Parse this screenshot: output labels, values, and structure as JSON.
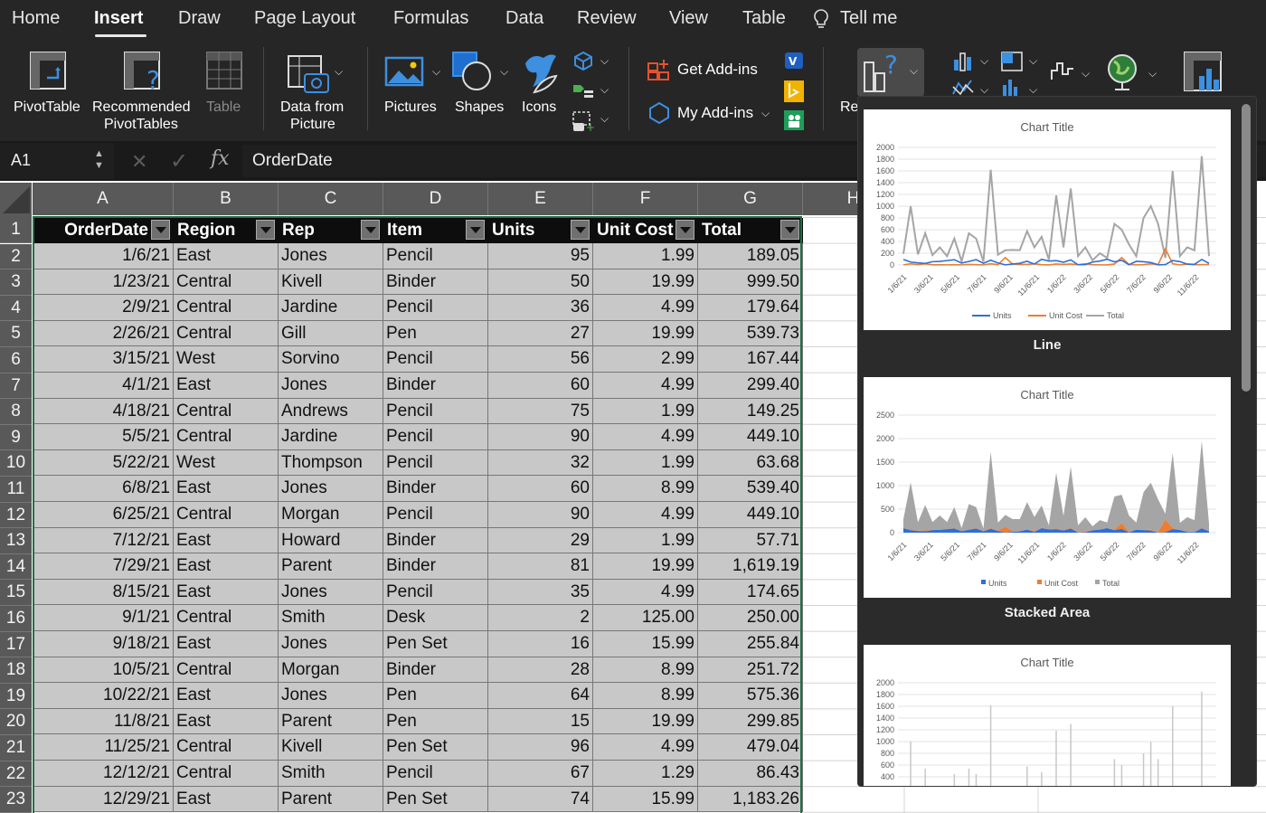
{
  "tabs": [
    "Home",
    "Insert",
    "Draw",
    "Page Layout",
    "Formulas",
    "Data",
    "Review",
    "View",
    "Table",
    "Tell me"
  ],
  "active_tab": "Insert",
  "ribbon": {
    "pivottable": "PivotTable",
    "recommended_pivottables_1": "Recommended",
    "recommended_pivottables_2": "PivotTables",
    "table": "Table",
    "data_from_picture_1": "Data from",
    "data_from_picture_2": "Picture",
    "pictures": "Pictures",
    "shapes": "Shapes",
    "icons": "Icons",
    "get_addins": "Get Add-ins",
    "my_addins": "My Add-ins",
    "recommended_charts_partial": "Re"
  },
  "formula_bar": {
    "name_box": "A1",
    "fx": "fx",
    "content": "OrderDate"
  },
  "columns": [
    "A",
    "B",
    "C",
    "D",
    "E",
    "F",
    "G",
    "H"
  ],
  "headers": [
    "OrderDate",
    "Region",
    "Rep",
    "Item",
    "Units",
    "Unit Cost",
    "Total"
  ],
  "rows": [
    [
      "1/6/21",
      "East",
      "Jones",
      "Pencil",
      "95",
      "1.99",
      "189.05"
    ],
    [
      "1/23/21",
      "Central",
      "Kivell",
      "Binder",
      "50",
      "19.99",
      "999.50"
    ],
    [
      "2/9/21",
      "Central",
      "Jardine",
      "Pencil",
      "36",
      "4.99",
      "179.64"
    ],
    [
      "2/26/21",
      "Central",
      "Gill",
      "Pen",
      "27",
      "19.99",
      "539.73"
    ],
    [
      "3/15/21",
      "West",
      "Sorvino",
      "Pencil",
      "56",
      "2.99",
      "167.44"
    ],
    [
      "4/1/21",
      "East",
      "Jones",
      "Binder",
      "60",
      "4.99",
      "299.40"
    ],
    [
      "4/18/21",
      "Central",
      "Andrews",
      "Pencil",
      "75",
      "1.99",
      "149.25"
    ],
    [
      "5/5/21",
      "Central",
      "Jardine",
      "Pencil",
      "90",
      "4.99",
      "449.10"
    ],
    [
      "5/22/21",
      "West",
      "Thompson",
      "Pencil",
      "32",
      "1.99",
      "63.68"
    ],
    [
      "6/8/21",
      "East",
      "Jones",
      "Binder",
      "60",
      "8.99",
      "539.40"
    ],
    [
      "6/25/21",
      "Central",
      "Morgan",
      "Pencil",
      "90",
      "4.99",
      "449.10"
    ],
    [
      "7/12/21",
      "East",
      "Howard",
      "Binder",
      "29",
      "1.99",
      "57.71"
    ],
    [
      "7/29/21",
      "East",
      "Parent",
      "Binder",
      "81",
      "19.99",
      "1,619.19"
    ],
    [
      "8/15/21",
      "East",
      "Jones",
      "Pencil",
      "35",
      "4.99",
      "174.65"
    ],
    [
      "9/1/21",
      "Central",
      "Smith",
      "Desk",
      "2",
      "125.00",
      "250.00"
    ],
    [
      "9/18/21",
      "East",
      "Jones",
      "Pen Set",
      "16",
      "15.99",
      "255.84"
    ],
    [
      "10/5/21",
      "Central",
      "Morgan",
      "Binder",
      "28",
      "8.99",
      "251.72"
    ],
    [
      "10/22/21",
      "East",
      "Jones",
      "Pen",
      "64",
      "8.99",
      "575.36"
    ],
    [
      "11/8/21",
      "East",
      "Parent",
      "Pen",
      "15",
      "19.99",
      "299.85"
    ],
    [
      "11/25/21",
      "Central",
      "Kivell",
      "Pen Set",
      "96",
      "4.99",
      "479.04"
    ],
    [
      "12/12/21",
      "Central",
      "Smith",
      "Pencil",
      "67",
      "1.29",
      "86.43"
    ],
    [
      "12/29/21",
      "East",
      "Parent",
      "Pen Set",
      "74",
      "15.99",
      "1,183.26"
    ]
  ],
  "row_numbers": [
    "1",
    "2",
    "3",
    "4",
    "5",
    "6",
    "7",
    "8",
    "9",
    "10",
    "11",
    "12",
    "13",
    "14",
    "15",
    "16",
    "17",
    "18",
    "19",
    "20",
    "21",
    "22",
    "23"
  ],
  "colors": {
    "units": "#2e6fd6",
    "unit_cost": "#ed7d31",
    "total": "#a5a5a5"
  },
  "chart_gallery": {
    "chart_title": "Chart Title",
    "x_labels": [
      "1/6/21",
      "3/6/21",
      "5/6/21",
      "7/6/21",
      "9/6/21",
      "11/6/21",
      "1/6/22",
      "3/6/22",
      "5/6/22",
      "7/6/22",
      "9/6/22",
      "11/6/22"
    ],
    "legend": [
      "Units",
      "Unit Cost",
      "Total"
    ],
    "items": [
      {
        "label": "Line",
        "type": "line",
        "y_ticks": [
          "2000",
          "1800",
          "1600",
          "1400",
          "1200",
          "1000",
          "800",
          "600",
          "400",
          "200",
          "0"
        ]
      },
      {
        "label": "Stacked Area",
        "type": "area",
        "y_ticks": [
          "2500",
          "2000",
          "1500",
          "1000",
          "500",
          "0"
        ]
      },
      {
        "label": "",
        "type": "bar",
        "y_ticks": [
          "2000",
          "1800",
          "1600",
          "1400",
          "1200",
          "1000",
          "800",
          "600",
          "400"
        ]
      }
    ]
  },
  "chart_data": {
    "type": "line",
    "title": "Chart Title",
    "series": [
      {
        "name": "Total",
        "values": [
          189.05,
          999.5,
          179.64,
          539.73,
          167.44,
          299.4,
          149.25,
          449.1,
          63.68,
          539.4,
          449.1,
          57.71,
          1619.19,
          174.65,
          250.0,
          255.84,
          251.72,
          575.36,
          299.85,
          479.04,
          86.43,
          1183.26,
          300,
          1300,
          150,
          300,
          80,
          200,
          120,
          700,
          600,
          350,
          150,
          800,
          1000,
          700,
          120,
          1600,
          150,
          300,
          250,
          1850,
          150
        ]
      },
      {
        "name": "Units",
        "values": [
          95,
          50,
          36,
          27,
          56,
          60,
          75,
          90,
          32,
          60,
          90,
          29,
          81,
          35,
          2,
          16,
          28,
          64,
          15,
          96,
          67,
          74,
          46,
          87,
          4,
          7,
          50,
          66,
          96,
          53,
          80,
          5,
          62,
          55,
          42,
          3,
          7,
          76,
          57,
          14,
          11,
          94,
          28
        ]
      },
      {
        "name": "Unit Cost",
        "values": [
          1.99,
          19.99,
          4.99,
          19.99,
          2.99,
          4.99,
          1.99,
          4.99,
          1.99,
          8.99,
          4.99,
          1.99,
          19.99,
          4.99,
          125,
          15.99,
          8.99,
          8.99,
          19.99,
          4.99,
          1.29,
          15.99,
          8.99,
          15.99,
          4.99,
          19.99,
          4.99,
          1.99,
          1.29,
          15.99,
          125,
          8.99,
          1.99,
          4.99,
          19.99,
          4.99,
          275,
          19.99,
          1.99,
          15.99,
          4.99,
          4.99,
          8.99
        ]
      }
    ],
    "ylim": [
      0,
      2000
    ]
  }
}
